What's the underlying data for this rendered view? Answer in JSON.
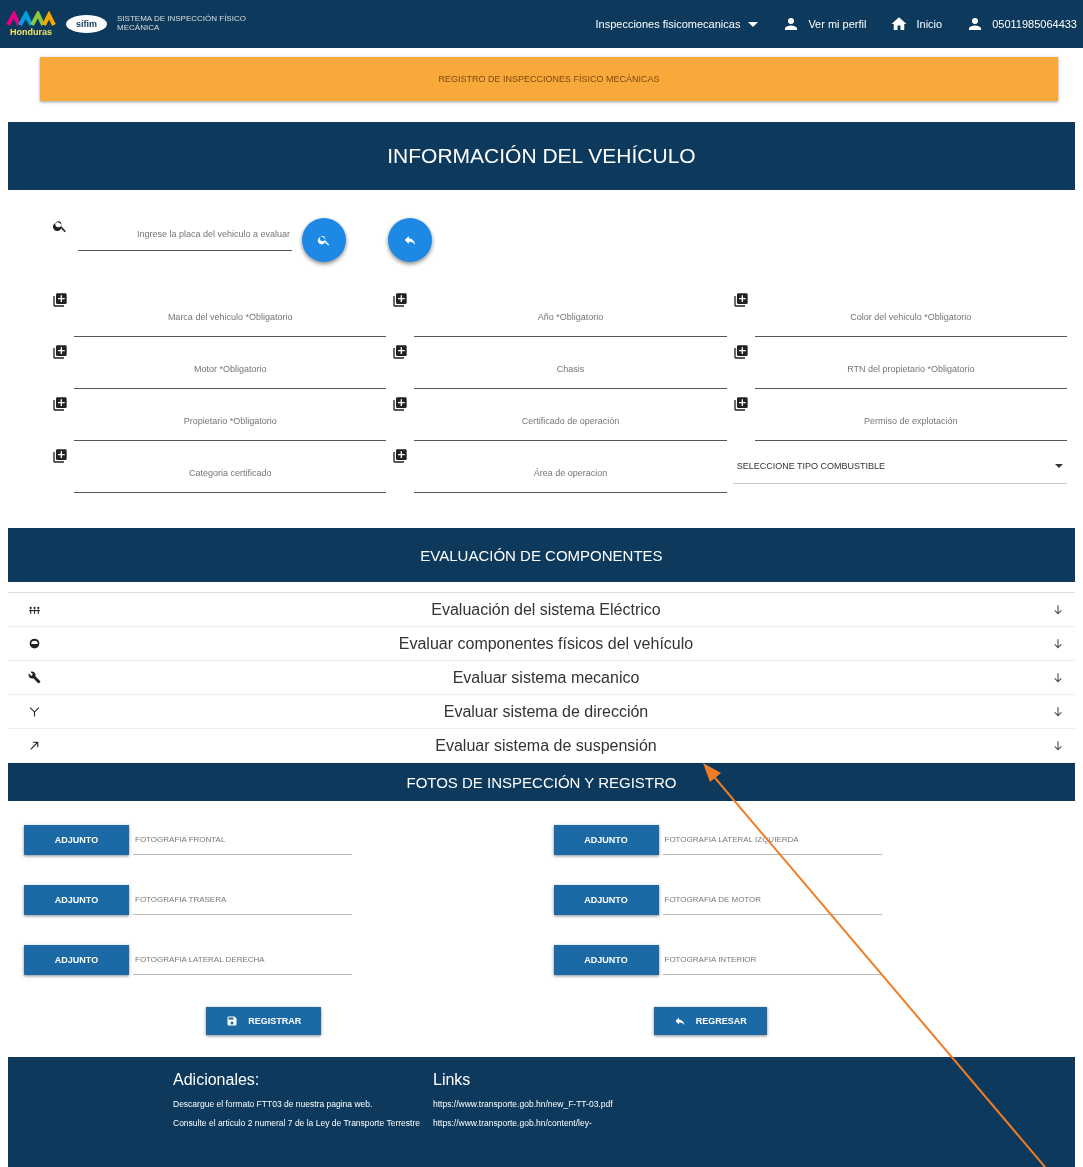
{
  "header": {
    "logo_text": "Honduras",
    "seal_text": "sifim",
    "system_name": "SISTEMA DE INSPECCIÓN FÍSICO MECÁNICA",
    "menu": "Inspecciones fisicomecanicas",
    "nav": [
      {
        "label": "Ver mi perfil"
      },
      {
        "label": "Inicio"
      },
      {
        "label": "05011985064433"
      }
    ]
  },
  "banner": "REGISTRO DE INSPECCIONES FÍSICO MECÁNICAS",
  "vehicle_section": {
    "title": "INFORMACIÓN DEL VEHÍCULO",
    "search": {
      "placeholder": "Ingrese la placa del vehiculo a evaluar"
    },
    "fields": [
      {
        "kind": "input",
        "placeholder": "Marca del vehiculo *Obligatorio"
      },
      {
        "kind": "input",
        "placeholder": "Año *Obligatorio"
      },
      {
        "kind": "input",
        "placeholder": "Color del vehiculo *Obligatorio"
      },
      {
        "kind": "input",
        "placeholder": "Motor *Obligatorio"
      },
      {
        "kind": "input",
        "placeholder": "Chasis"
      },
      {
        "kind": "input",
        "placeholder": "RTN del propietario *Obligatorio"
      },
      {
        "kind": "input",
        "placeholder": "Propietario *Obligatorio"
      },
      {
        "kind": "input",
        "placeholder": "Certificado de operación"
      },
      {
        "kind": "input",
        "placeholder": "Permiso de explotación"
      },
      {
        "kind": "input",
        "placeholder": "Categoria certificado"
      },
      {
        "kind": "input",
        "placeholder": "Área de operacion"
      },
      {
        "kind": "select",
        "value": "SELECCIONE TIPO COMBUSTIBLE"
      }
    ]
  },
  "components_section": {
    "title": "EVALUACIÓN DE COMPONENTES",
    "items": [
      {
        "label": "Evaluación del sistema Eléctrico"
      },
      {
        "label": "Evaluar componentes físicos del vehículo"
      },
      {
        "label": "Evaluar sistema mecanico"
      },
      {
        "label": "Evaluar sistema de dirección"
      },
      {
        "label": "Evaluar sistema de suspensión"
      }
    ]
  },
  "photos_section": {
    "title": "FOTOS DE INSPECCIÓN Y REGISTRO",
    "photos": [
      {
        "button": "ADJUNTO",
        "placeholder": "FOTOGRAFIA FRONTAL"
      },
      {
        "button": "ADJUNTO",
        "placeholder": "FOTOGRAFIA LATERAL IZQUIERDA"
      },
      {
        "button": "ADJUNTO",
        "placeholder": "FOTOGRAFIA TRASERA"
      },
      {
        "button": "ADJUNTO",
        "placeholder": "FOTOGRAFIA DE MOTOR"
      },
      {
        "button": "ADJUNTO",
        "placeholder": "FOTOGRAFIA LATERAL DERECHA"
      },
      {
        "button": "ADJUNTO",
        "placeholder": "FOTOGRAFIA INTERIOR"
      }
    ],
    "actions": [
      {
        "kind": "save",
        "label": "REGISTRAR"
      },
      {
        "kind": "back",
        "label": "REGRESAR"
      }
    ]
  },
  "footer": {
    "columns": [
      {
        "title": "Adicionales:",
        "lines": [
          "Descargue el formato FTT03 de nuestra pagina web.",
          "Consulte el articulo 2 numeral 7 de la Ley de Transporte Terrestre"
        ]
      },
      {
        "title": "Links",
        "lines": [
          "https://www.transporte.gob.hn/new_F-TT-03.pdf",
          "https://www.transporte.gob.hn/content/ley-"
        ]
      }
    ]
  }
}
